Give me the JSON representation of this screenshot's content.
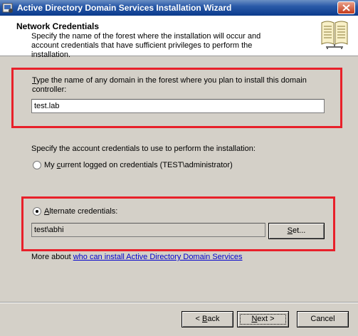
{
  "window": {
    "title": "Active Directory Domain Services Installation Wizard"
  },
  "header": {
    "title": "Network Credentials",
    "description": "Specify the name of the forest where the installation will occur and account credentials that have sufficient privileges to perform the installation."
  },
  "domain": {
    "label_prefix": "T",
    "label_rest": "ype the name of any domain in the forest where you plan to install this domain controller:",
    "value": "test.lab"
  },
  "credentials": {
    "prompt": "Specify the account credentials to use to perform the installation:",
    "current_option": {
      "pre": "My ",
      "accel": "c",
      "post": "urrent logged on credentials (TEST\\administrator)",
      "checked": false
    },
    "alternate_option": {
      "accel": "A",
      "post": "lternate credentials:",
      "checked": true
    },
    "alternate_value": "test\\abhi",
    "set_button": {
      "accel": "S",
      "post": "et..."
    }
  },
  "more": {
    "prefix": "More about ",
    "link": "who can install Active Directory Domain Services"
  },
  "footer": {
    "back": {
      "pre": "< ",
      "accel": "B",
      "post": "ack"
    },
    "next": {
      "accel": "N",
      "post": "ext >"
    },
    "cancel": "Cancel"
  }
}
